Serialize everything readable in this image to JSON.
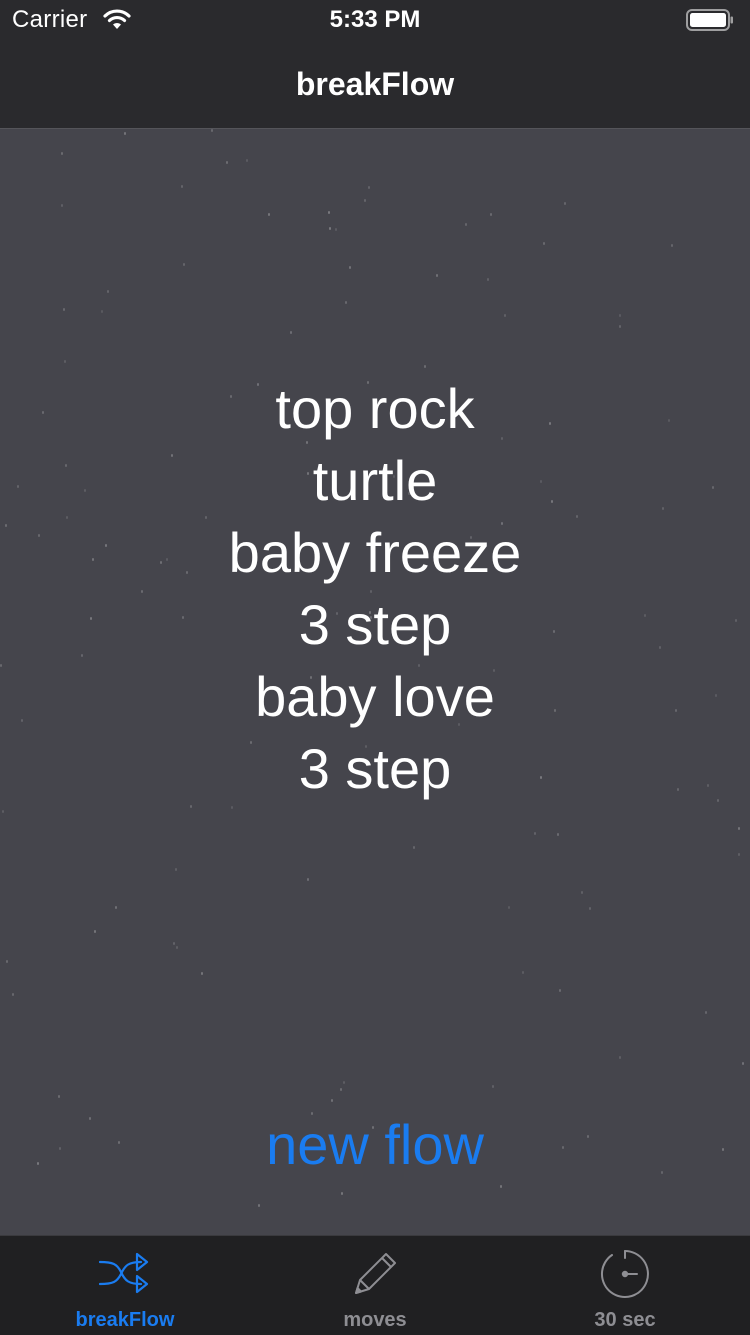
{
  "status_bar": {
    "carrier": "Carrier",
    "time": "5:33 PM",
    "icons": [
      "wifi-icon",
      "battery-icon"
    ]
  },
  "nav": {
    "title": "breakFlow"
  },
  "flow": {
    "moves": [
      "top rock",
      "turtle",
      "baby freeze",
      "3 step",
      "baby love",
      "3 step"
    ]
  },
  "actions": {
    "new_flow": "new flow"
  },
  "tabs": [
    {
      "label": "breakFlow",
      "icon": "shuffle-icon",
      "active": true
    },
    {
      "label": "moves",
      "icon": "pencil-icon",
      "active": false
    },
    {
      "label": "30 sec",
      "icon": "timer-icon",
      "active": false
    }
  ],
  "colors": {
    "accent": "#1a7cf0",
    "bar_background": "#2a2a2d",
    "content_background": "#45454c",
    "tab_inactive": "#8e8e93"
  }
}
